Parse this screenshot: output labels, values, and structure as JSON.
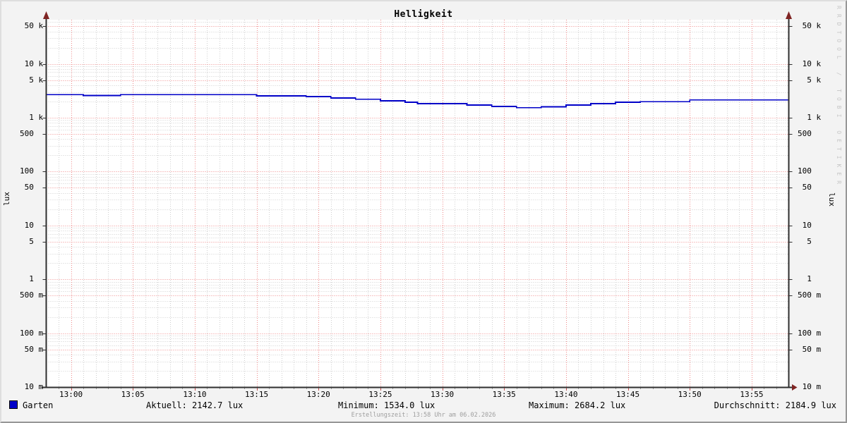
{
  "title": "Helligkeit",
  "watermark": "RRDTOOL / TOBI OETIKER",
  "y_axis": {
    "unit_left": "lux",
    "unit_right": "lux",
    "ticks": [
      {
        "label": " 50 k",
        "value": 50000
      },
      {
        "label": " 10 k",
        "value": 10000
      },
      {
        "label": "  5 k",
        "value": 5000
      },
      {
        "label": "  1 k",
        "value": 1000
      },
      {
        "label": "500",
        "value": 500
      },
      {
        "label": "100",
        "value": 100
      },
      {
        "label": " 50",
        "value": 50
      },
      {
        "label": " 10",
        "value": 10
      },
      {
        "label": "  5",
        "value": 5
      },
      {
        "label": "  1",
        "value": 1
      },
      {
        "label": "500 m",
        "value": 0.5
      },
      {
        "label": "100 m",
        "value": 0.1
      },
      {
        "label": " 50 m",
        "value": 0.05
      },
      {
        "label": " 10 m",
        "value": 0.01
      }
    ]
  },
  "x_axis": {
    "ticks": [
      "13:00",
      "13:05",
      "13:10",
      "13:15",
      "13:20",
      "13:25",
      "13:30",
      "13:35",
      "13:40",
      "13:45",
      "13:50",
      "13:55"
    ]
  },
  "legend": {
    "series_label": "Garten",
    "series_color": "#0000c8"
  },
  "stats": {
    "aktuell": "Aktuell: 2142.7 lux",
    "minimum": "Minimum: 1534.0 lux",
    "maximum": "Maximum: 2684.2 lux",
    "durchschnitt": "Durchschnitt: 2184.9 lux"
  },
  "footer": "Erstellungszeit: 13:58 Uhr am 06.02.2026",
  "colors": {
    "background": "#f3f3f3",
    "canvas": "#ffffff",
    "axis": "#2f2f2f",
    "arrow": "#7f2423",
    "line": "#0000c8",
    "grid_major": "#ef8a8a",
    "grid_minor": "#cfcfcf",
    "tick_major": "#c05050",
    "tick_minor": "#9a9a9a"
  },
  "chart_data": {
    "type": "line",
    "draw_style": "step-after",
    "y_scale": "log",
    "title": "Helligkeit",
    "xlabel": "",
    "ylabel": "lux",
    "x_range": [
      "12:58",
      "13:58"
    ],
    "y_range_lux": [
      0.01,
      66000
    ],
    "x_major_tick_interval_min": 5,
    "x_minor_tick_interval_min": 1,
    "y_major_ticks_lux": [
      50000,
      10000,
      5000,
      1000,
      500,
      100,
      50,
      10,
      5,
      1,
      0.5,
      0.1,
      0.05,
      0.01
    ],
    "y_minor_mantissas": [
      2,
      3,
      4,
      6,
      7,
      8,
      9
    ],
    "legend_position": "bottom",
    "grid": true,
    "series": [
      {
        "name": "Garten",
        "color": "#0000c8",
        "points": [
          [
            "12:58",
            2684
          ],
          [
            "13:01",
            2580
          ],
          [
            "13:04",
            2684
          ],
          [
            "13:15",
            2550
          ],
          [
            "13:19",
            2480
          ],
          [
            "13:21",
            2330
          ],
          [
            "13:23",
            2200
          ],
          [
            "13:25",
            2070
          ],
          [
            "13:27",
            1940
          ],
          [
            "13:28",
            1830
          ],
          [
            "13:32",
            1720
          ],
          [
            "13:34",
            1620
          ],
          [
            "13:36",
            1534
          ],
          [
            "13:38",
            1600
          ],
          [
            "13:40",
            1720
          ],
          [
            "13:42",
            1830
          ],
          [
            "13:44",
            1940
          ],
          [
            "13:46",
            1985
          ],
          [
            "13:50",
            2143
          ],
          [
            "13:58",
            2143
          ]
        ]
      }
    ],
    "summary": {
      "aktuell_lux": 2142.7,
      "minimum_lux": 1534.0,
      "maximum_lux": 2684.2,
      "durchschnitt_lux": 2184.9
    }
  }
}
